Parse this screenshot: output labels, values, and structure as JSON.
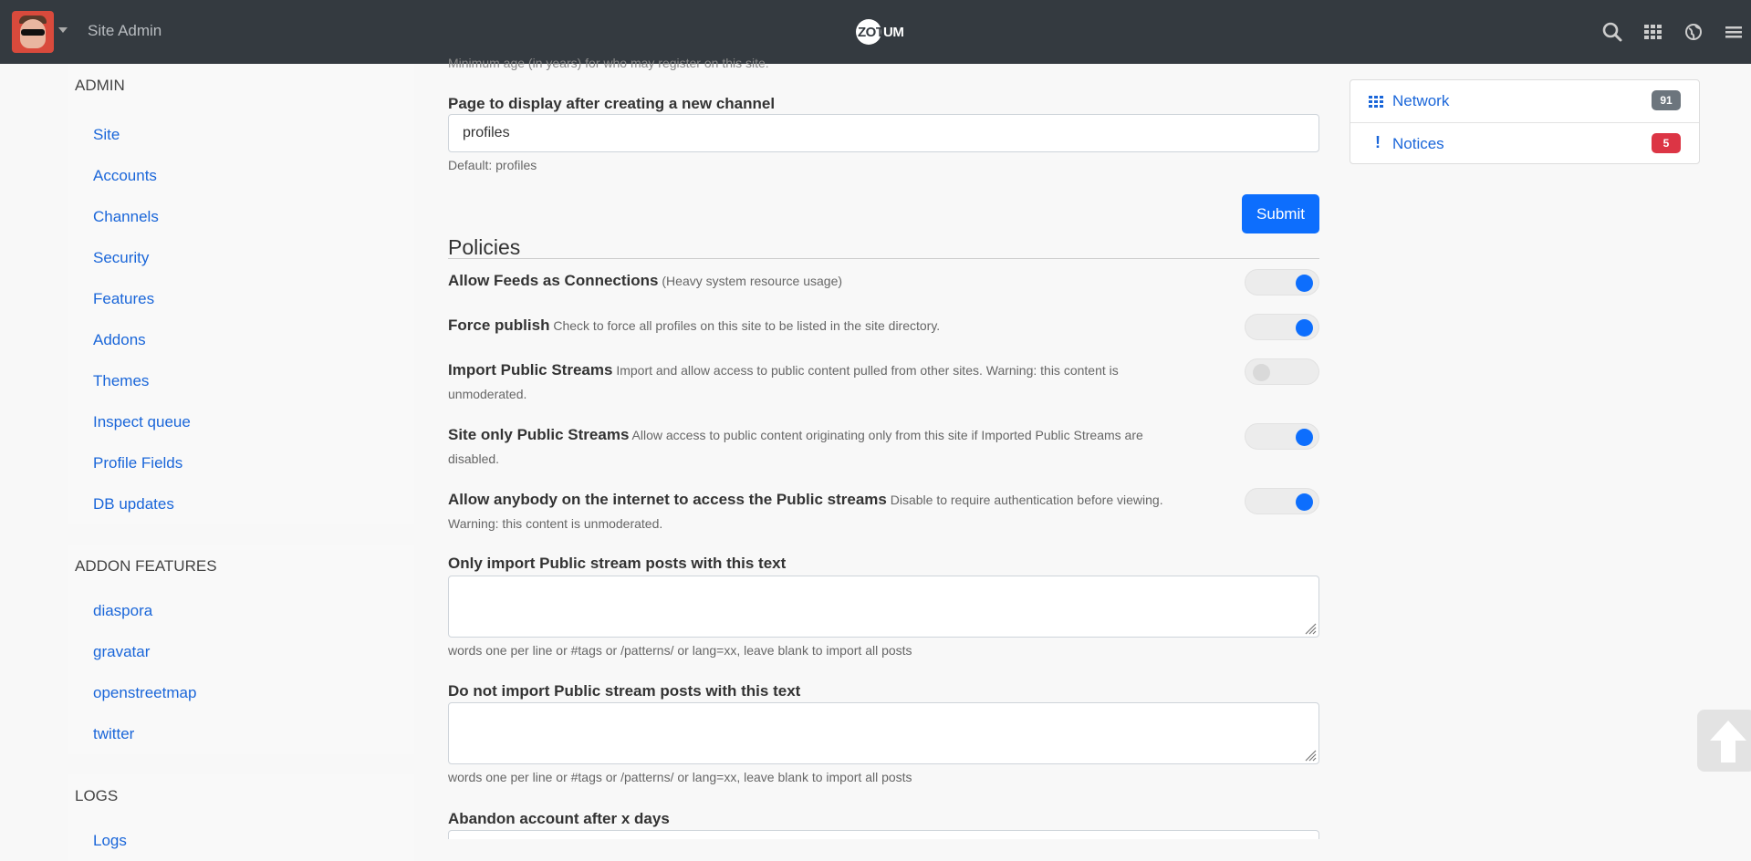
{
  "topbar": {
    "site_title": "Site Admin",
    "logo_text_a": "ZOT",
    "logo_text_b": "UM",
    "icons": [
      "search-icon",
      "apps-grid-icon",
      "globe-icon",
      "hamburger-menu-icon"
    ]
  },
  "sidebar": {
    "admin": {
      "heading": "ADMIN",
      "items": [
        "Site",
        "Accounts",
        "Channels",
        "Security",
        "Features",
        "Addons",
        "Themes",
        "Inspect queue",
        "Profile Fields",
        "DB updates"
      ]
    },
    "addon_features": {
      "heading": "ADDON FEATURES",
      "items": [
        "diaspora",
        "gravatar",
        "openstreetmap",
        "twitter"
      ]
    },
    "logs": {
      "heading": "LOGS",
      "items": [
        "Logs"
      ]
    }
  },
  "main": {
    "cutoff_help": "Minimum age (in years) for who may register on this site.",
    "new_channel": {
      "label": "Page to display after creating a new channel",
      "value": "profiles",
      "help": "Default: profiles"
    },
    "submit_label": "Submit",
    "policies_heading": "Policies",
    "policies": [
      {
        "title": "Allow Feeds as Connections",
        "desc": "(Heavy system resource usage)",
        "enabled": true
      },
      {
        "title": "Force publish",
        "desc": "Check to force all profiles on this site to be listed in the site directory.",
        "enabled": true
      },
      {
        "title": "Import Public Streams",
        "desc": "Import and allow access to public content pulled from other sites. Warning: this content is unmoderated.",
        "enabled": false
      },
      {
        "title": "Site only Public Streams",
        "desc": "Allow access to public content originating only from this site if Imported Public Streams are disabled.",
        "enabled": true
      },
      {
        "title": "Allow anybody on the internet to access the Public streams",
        "desc": "Disable to require authentication before viewing. Warning: this content is unmoderated.",
        "enabled": true
      }
    ],
    "only_import": {
      "label": "Only import Public stream posts with this text",
      "help": "words one per line or #tags or /patterns/ or lang=xx, leave blank to import all posts"
    },
    "do_not_import": {
      "label": "Do not import Public stream posts with this text",
      "help": "words one per line or #tags or /patterns/ or lang=xx, leave blank to import all posts"
    },
    "abandon_label": "Abandon account after x days"
  },
  "widget": {
    "network": {
      "label": "Network",
      "count": "91",
      "color": "#6c757d"
    },
    "notices": {
      "label": "Notices",
      "count": "5",
      "color": "#dc3545"
    }
  },
  "colors": {
    "topbar": "#343a40",
    "link": "#1a66d9",
    "primary": "#0d6efd"
  }
}
